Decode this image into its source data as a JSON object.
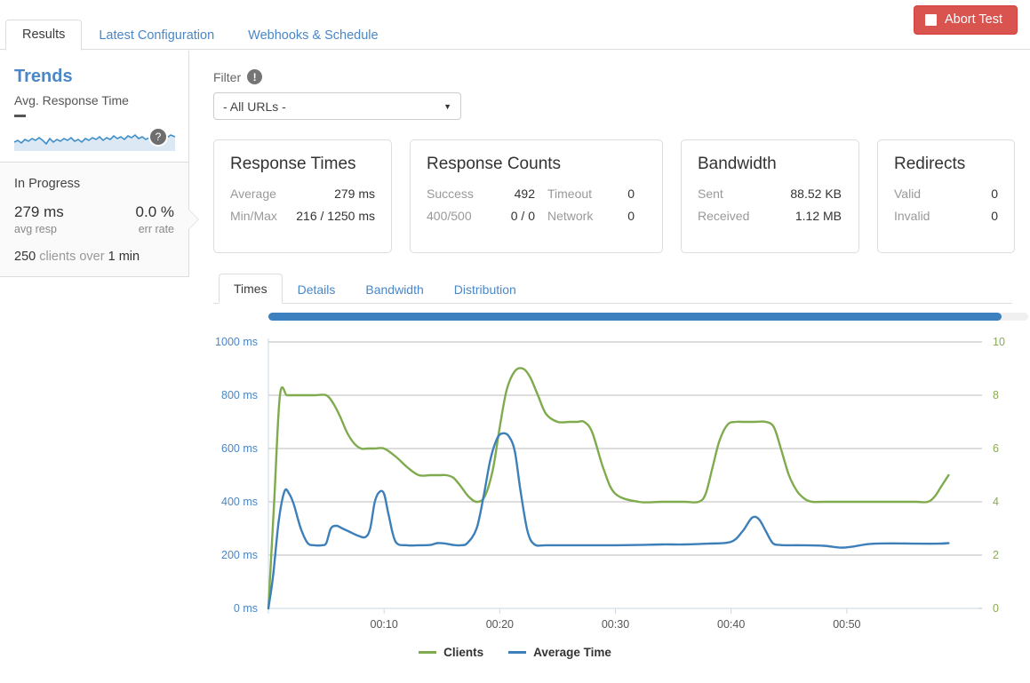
{
  "header": {
    "abort_button": "Abort Test",
    "abort_color": "#d9534f",
    "tabs": [
      {
        "label": "Results",
        "active": true
      },
      {
        "label": "Latest Configuration",
        "active": false
      },
      {
        "label": "Webhooks & Schedule",
        "active": false
      }
    ]
  },
  "sidebar": {
    "trends_title": "Trends",
    "trends_subtitle": "Avg. Response Time",
    "sparkline_value": "–",
    "sparkline_badge": "?",
    "status": "In Progress",
    "avg_resp_value": "279 ms",
    "avg_resp_label": "avg resp",
    "err_rate_value": "0.0 %",
    "err_rate_label": "err rate",
    "clients_count": "250",
    "clients_text_1": "clients over",
    "duration": "1 min"
  },
  "filter": {
    "label": "Filter",
    "info_icon": "!",
    "selected": "- All URLs -",
    "caret": "▼"
  },
  "cards": [
    {
      "title": "Response Times",
      "rows": [
        {
          "k": "Average",
          "v": "279 ms"
        },
        {
          "k": "Min/Max",
          "v": "216 / 1250 ms"
        }
      ]
    },
    {
      "title": "Response Counts",
      "rows": [
        {
          "k": "Success",
          "v": "492",
          "k2": "Timeout",
          "v2": "0"
        },
        {
          "k": "400/500",
          "v": "0 / 0",
          "k2": "Network",
          "v2": "0"
        }
      ]
    },
    {
      "title": "Bandwidth",
      "rows": [
        {
          "k": "Sent",
          "v": "88.52 KB"
        },
        {
          "k": "Received",
          "v": "1.12 MB"
        }
      ]
    },
    {
      "title": "Redirects",
      "rows": [
        {
          "k": "Valid",
          "v": "0"
        },
        {
          "k": "Invalid",
          "v": "0"
        }
      ]
    }
  ],
  "chart_tabs": [
    {
      "label": "Times",
      "active": true
    },
    {
      "label": "Details",
      "active": false
    },
    {
      "label": "Bandwidth",
      "active": false
    },
    {
      "label": "Distribution",
      "active": false
    }
  ],
  "chart_data": {
    "type": "line",
    "title": "",
    "xlabel": "",
    "ylabel": "",
    "grid": true,
    "legend_position": "bottom",
    "x_ticks": [
      "00:10",
      "00:20",
      "00:30",
      "00:40",
      "00:50"
    ],
    "x_tick_seconds": [
      10,
      20,
      30,
      40,
      50
    ],
    "xlim": [
      0,
      60
    ],
    "left_axis": {
      "label": "ms",
      "color": "#4a87c7",
      "ylim": [
        0,
        1000
      ],
      "ticks": [
        0,
        200,
        400,
        600,
        800,
        1000
      ],
      "tick_labels": [
        "0 ms",
        "200 ms",
        "400 ms",
        "600 ms",
        "800 ms",
        "1000 ms"
      ]
    },
    "right_axis": {
      "label": "clients",
      "color": "#8aab55",
      "ylim": [
        0,
        10
      ],
      "ticks": [
        0,
        2,
        4,
        6,
        8,
        10
      ],
      "tick_labels": [
        "0",
        "2",
        "4",
        "6",
        "8",
        "10"
      ]
    },
    "series": [
      {
        "name": "Clients",
        "color": "#7fab4e",
        "axis": "right",
        "x": [
          0.0,
          0.5,
          1.0,
          1.6,
          2.2,
          3.0,
          4.0,
          5.0,
          5.6,
          6.2,
          6.8,
          7.4,
          8.0,
          8.6,
          9.2,
          10.0,
          11.0,
          12.0,
          13.0,
          14.0,
          14.8,
          15.4,
          16.0,
          16.6,
          17.3,
          18.0,
          18.7,
          19.4,
          20.0,
          20.6,
          21.3,
          22.0,
          22.6,
          23.3,
          24.0,
          25.0,
          26.0,
          26.7,
          27.3,
          28.0,
          29.0,
          30.0,
          32.0,
          34.0,
          36.0,
          37.2,
          37.8,
          38.4,
          39.0,
          39.7,
          40.4,
          41.0,
          42.0,
          43.0,
          43.7,
          44.3,
          45.0,
          45.7,
          46.4,
          47.0,
          48.0,
          50.0,
          52.0,
          54.0,
          56.0,
          57.0,
          57.6,
          58.2,
          58.8
        ],
        "values": [
          0.0,
          4.0,
          8.0,
          8.0,
          8.0,
          8.0,
          8.0,
          8.0,
          7.7,
          7.2,
          6.6,
          6.2,
          6.0,
          6.0,
          6.0,
          6.0,
          5.7,
          5.3,
          5.0,
          5.0,
          5.0,
          5.0,
          4.9,
          4.6,
          4.2,
          4.0,
          4.2,
          5.2,
          6.8,
          8.2,
          8.9,
          9.0,
          8.7,
          8.0,
          7.3,
          7.0,
          7.0,
          7.0,
          7.0,
          6.6,
          5.2,
          4.3,
          4.0,
          4.0,
          4.0,
          4.0,
          4.3,
          5.3,
          6.3,
          6.9,
          7.0,
          7.0,
          7.0,
          7.0,
          6.8,
          6.0,
          5.0,
          4.4,
          4.1,
          4.0,
          4.0,
          4.0,
          4.0,
          4.0,
          4.0,
          4.0,
          4.2,
          4.6,
          5.0
        ]
      },
      {
        "name": "Average Time",
        "color": "#3d7fb8",
        "axis": "left",
        "x": [
          0.0,
          0.4,
          0.9,
          1.4,
          1.8,
          2.2,
          2.8,
          3.4,
          4.0,
          4.6,
          5.0,
          5.4,
          5.9,
          6.4,
          7.0,
          7.8,
          8.4,
          8.8,
          9.2,
          9.6,
          10.0,
          10.4,
          11.0,
          12.0,
          13.0,
          14.0,
          14.6,
          15.2,
          16.0,
          16.6,
          17.2,
          18.0,
          18.6,
          19.2,
          19.8,
          20.3,
          20.8,
          21.3,
          21.8,
          22.4,
          23.0,
          24.0,
          26.0,
          28.0,
          30.0,
          32.0,
          34.0,
          36.0,
          38.0,
          40.0,
          41.0,
          41.8,
          42.4,
          43.0,
          43.6,
          44.2,
          45.0,
          46.0,
          48.0,
          49.5,
          50.5,
          52.0,
          54.0,
          56.0,
          58.0,
          58.8
        ],
        "values": [
          0,
          120,
          330,
          440,
          430,
          390,
          300,
          245,
          237,
          237,
          245,
          300,
          310,
          300,
          288,
          272,
          268,
          300,
          400,
          437,
          430,
          350,
          250,
          237,
          237,
          238,
          245,
          244,
          238,
          237,
          245,
          300,
          420,
          560,
          640,
          657,
          645,
          590,
          440,
          290,
          240,
          237,
          237,
          237,
          237,
          238,
          240,
          240,
          243,
          250,
          290,
          340,
          335,
          290,
          245,
          238,
          237,
          237,
          235,
          228,
          232,
          242,
          244,
          243,
          243,
          245
        ]
      }
    ]
  },
  "legend": [
    {
      "label": "Clients",
      "color": "#7fab4e"
    },
    {
      "label": "Average Time",
      "color": "#3d7fb8"
    }
  ]
}
